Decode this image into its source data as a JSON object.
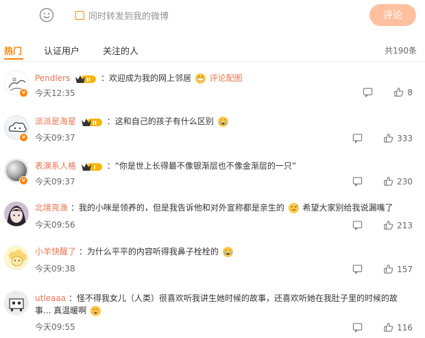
{
  "composer": {
    "repost_label": "同时转发到我的微博",
    "submit_label": "评论"
  },
  "tabs": [
    {
      "label": "热门"
    },
    {
      "label": "认证用户"
    },
    {
      "label": "关注的人"
    }
  ],
  "total": "共190条",
  "comments": [
    {
      "user": "Pendlers",
      "level": "II",
      "sep": "：",
      "text": "欢迎成为我的网上邻居",
      "extra": "评论配图",
      "time": "今天12:35",
      "likes": "8"
    },
    {
      "user": "派派是海星",
      "level": "II",
      "sep": "：",
      "text": "这和自己的孩子有什么区别",
      "time": "今天09:37",
      "likes": "333"
    },
    {
      "user": "表演系人格",
      "level": "I",
      "sep": "：",
      "text": "“你是世上长得最不像银渐层也不像金渐层的一只”",
      "time": "今天09:37",
      "likes": "230"
    },
    {
      "user": "北境亮渔",
      "sep": "：",
      "text": "我的小咪是领养的，但是我告诉他和对外宣称都是亲生的",
      "text2": "希望大家别给我说漏嘴了",
      "time": "今天09:56",
      "likes": "213"
    },
    {
      "user": "小羊快醒了",
      "sep": "：",
      "text": "为什么平平的内容听得我鼻子栓栓的",
      "time": "今天09:38",
      "likes": "157"
    },
    {
      "user": "utleaaa",
      "sep": "：",
      "text": "怪不得我女儿（人类）很喜欢听我讲生她时候的故事，还喜欢听她在我肚子里的时候的故事...",
      "text2": "真温暖啊",
      "time": "今天09:55",
      "likes": "116"
    }
  ],
  "colors": {
    "accent": "#ff8200",
    "username": "#eb7350",
    "submit_bg": "#ffc09f"
  }
}
